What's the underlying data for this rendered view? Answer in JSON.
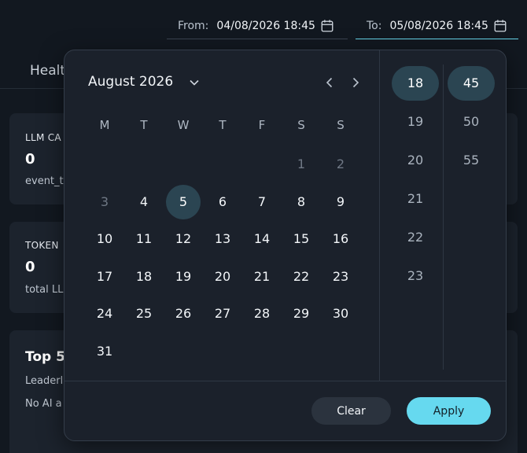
{
  "header": {
    "from_label": "From:",
    "from_value": "04/08/2026 18:45",
    "to_label": "To:",
    "to_value": "05/08/2026 18:45"
  },
  "dashboard": {
    "tab_health": "Healt",
    "card1": {
      "title": "LLM CA",
      "value": "0",
      "sub": "event_t"
    },
    "card2": {
      "title": "TOKEN",
      "value": "0",
      "sub": "total LL"
    },
    "card3": {
      "title": "Top 5",
      "sub1": "Leaderl",
      "sub2": "No AI a"
    }
  },
  "picker": {
    "month": "August 2026",
    "weekdays": [
      "M",
      "T",
      "W",
      "T",
      "F",
      "S",
      "S"
    ],
    "weeks": [
      [
        {
          "d": ""
        },
        {
          "d": ""
        },
        {
          "d": ""
        },
        {
          "d": ""
        },
        {
          "d": ""
        },
        {
          "d": "1",
          "muted": true
        },
        {
          "d": "2",
          "muted": true
        }
      ],
      [
        {
          "d": "3",
          "muted": true
        },
        {
          "d": "4"
        },
        {
          "d": "5",
          "selected": true
        },
        {
          "d": "6"
        },
        {
          "d": "7"
        },
        {
          "d": "8"
        },
        {
          "d": "9"
        }
      ],
      [
        {
          "d": "10"
        },
        {
          "d": "11"
        },
        {
          "d": "12"
        },
        {
          "d": "13"
        },
        {
          "d": "14"
        },
        {
          "d": "15"
        },
        {
          "d": "16"
        }
      ],
      [
        {
          "d": "17"
        },
        {
          "d": "18"
        },
        {
          "d": "19"
        },
        {
          "d": "20"
        },
        {
          "d": "21"
        },
        {
          "d": "22"
        },
        {
          "d": "23"
        }
      ],
      [
        {
          "d": "24"
        },
        {
          "d": "25"
        },
        {
          "d": "26"
        },
        {
          "d": "27"
        },
        {
          "d": "28"
        },
        {
          "d": "29"
        },
        {
          "d": "30"
        }
      ],
      [
        {
          "d": "31"
        },
        {
          "d": ""
        },
        {
          "d": ""
        },
        {
          "d": ""
        },
        {
          "d": ""
        },
        {
          "d": ""
        },
        {
          "d": ""
        }
      ]
    ],
    "hours": [
      "18",
      "19",
      "20",
      "21",
      "22",
      "23"
    ],
    "selected_hour": "18",
    "minutes": [
      "45",
      "50",
      "55"
    ],
    "selected_minute": "45",
    "clear_label": "Clear",
    "apply_label": "Apply"
  },
  "colors": {
    "accent": "#66d9ef",
    "selected_bg": "#2b4552",
    "background": "#121820",
    "panel": "#1b212b"
  },
  "icons": {
    "calendar": "calendar-icon",
    "chevron_down": "chevron-down-icon",
    "prev": "chevron-left-icon",
    "next": "chevron-right-icon"
  }
}
